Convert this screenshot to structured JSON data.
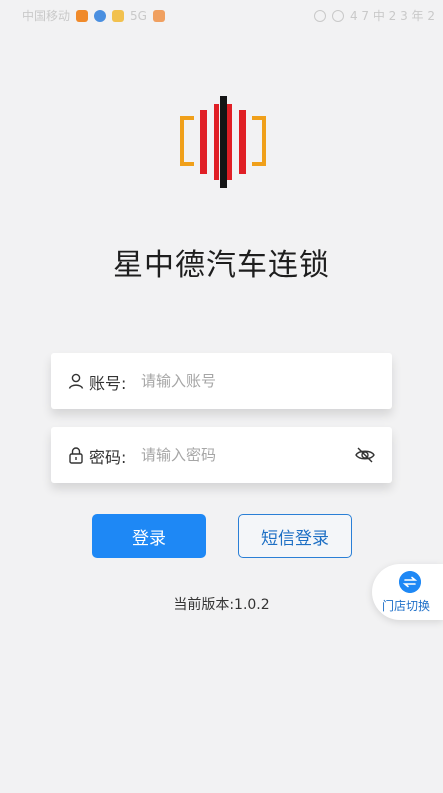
{
  "status_bar": {
    "carrier": "中国移动",
    "network": "5G",
    "right_text": "4 7 中 2 3 年 2"
  },
  "app": {
    "title": "星中德汽车连锁",
    "colors": {
      "brand_red": "#e01f25",
      "brand_orange": "#f0a01a",
      "brand_black": "#151515",
      "primary_blue": "#1e88f5"
    }
  },
  "form": {
    "account": {
      "icon": "user-icon",
      "label": "账号:",
      "value": "",
      "placeholder": "请输入账号"
    },
    "password": {
      "icon": "lock-icon",
      "label": "密码:",
      "value": "",
      "placeholder": "请输入密码",
      "toggle_icon": "eye-off-icon"
    }
  },
  "buttons": {
    "login": "登录",
    "sms_login": "短信登录"
  },
  "version_text": "当前版本:1.0.2",
  "store_switch": {
    "icon": "swap-icon",
    "label": "门店切换"
  }
}
